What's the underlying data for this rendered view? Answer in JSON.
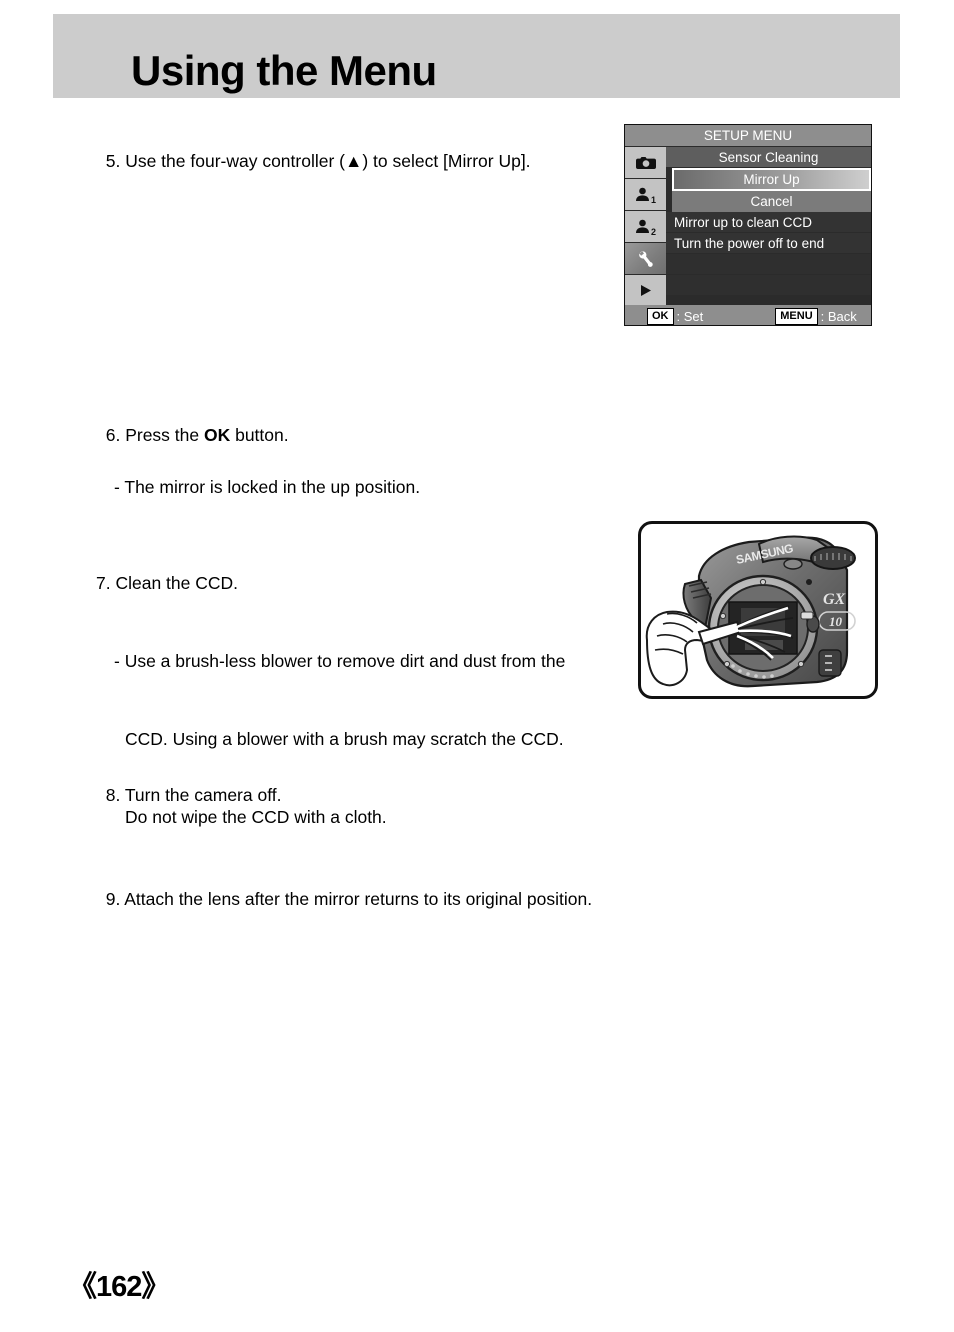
{
  "page": {
    "title": "Using the Menu",
    "number": "《162》"
  },
  "steps": {
    "step5": "5. Use the four-way controller (▲) to select [Mirror Up].",
    "step6_main_prefix": "6. Press the ",
    "step6_bold": "OK",
    "step6_main_suffix": " button.",
    "step6_sub": "- The mirror is locked in the up position.",
    "step7_main": "7. Clean the CCD.",
    "step7_sub1": "- Use a brush-less blower to remove dirt and dust from the",
    "step7_sub2": "CCD. Using a blower with a brush may scratch the CCD.",
    "step7_sub3": "Do not wipe the CCD with a cloth.",
    "step8": "8. Turn the camera off.",
    "step9": "9. Attach the lens after the mirror returns to its original position."
  },
  "lcd": {
    "title": "SETUP MENU",
    "tabs": [
      {
        "icon": "camera-icon",
        "sub": "",
        "selected": false
      },
      {
        "icon": "person-icon",
        "sub": "1",
        "selected": false
      },
      {
        "icon": "person-icon",
        "sub": "2",
        "selected": false
      },
      {
        "icon": "wrench-icon",
        "sub": "",
        "selected": true
      },
      {
        "icon": "play-icon",
        "sub": "",
        "selected": false
      }
    ],
    "rows": [
      {
        "label": "Sensor Cleaning",
        "style": "header"
      },
      {
        "label": "Mirror Up",
        "style": "highlight"
      },
      {
        "label": "Cancel",
        "style": "sub-item"
      },
      {
        "label": "Mirror up to clean CCD",
        "style": "dim"
      },
      {
        "label": "Turn the power off to end",
        "style": "dim"
      },
      {
        "label": "",
        "style": "empty"
      },
      {
        "label": "",
        "style": "empty"
      }
    ],
    "footer": {
      "ok_key": "OK",
      "ok_label": ": Set",
      "menu_key": "MENU",
      "menu_label": ": Back"
    }
  },
  "illustration": {
    "name": "camera-ccd-cleaning-illustration",
    "brand": "SAMSUNG",
    "model_line1": "GX",
    "model_line2": "10"
  },
  "colors": {
    "header_band": "#cccccc",
    "lcd_title_bar": "#8e8e8e",
    "lcd_row": "#5e5e5e",
    "lcd_row_dim": "#333333",
    "lcd_tab": "#c3c3c3"
  }
}
